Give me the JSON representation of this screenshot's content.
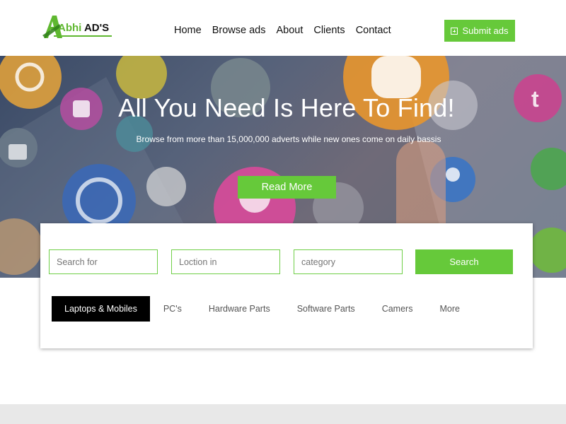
{
  "header": {
    "logo": {
      "part1": "Abhi",
      "part2": "AD'S"
    },
    "nav": [
      "Home",
      "Browse ads",
      "About",
      "Clients",
      "Contact"
    ],
    "submit_label": "Submit ads"
  },
  "hero": {
    "title": "All You Need Is Here To Find!",
    "subtitle": "Browse from more than 15,000,000 adverts while new ones come on daily bassis",
    "cta_label": "Read More"
  },
  "search": {
    "search_placeholder": "Search for",
    "location_placeholder": "Loction in",
    "category_placeholder": "category",
    "button_label": "Search"
  },
  "categories": {
    "items": [
      "Laptops & Mobiles",
      "PC's",
      "Hardware Parts",
      "Software Parts",
      "Camers",
      "More"
    ],
    "active_index": 0
  },
  "colors": {
    "accent": "#66c93a",
    "active_tab": "#000000",
    "footer_band": "#e8e8e8"
  }
}
